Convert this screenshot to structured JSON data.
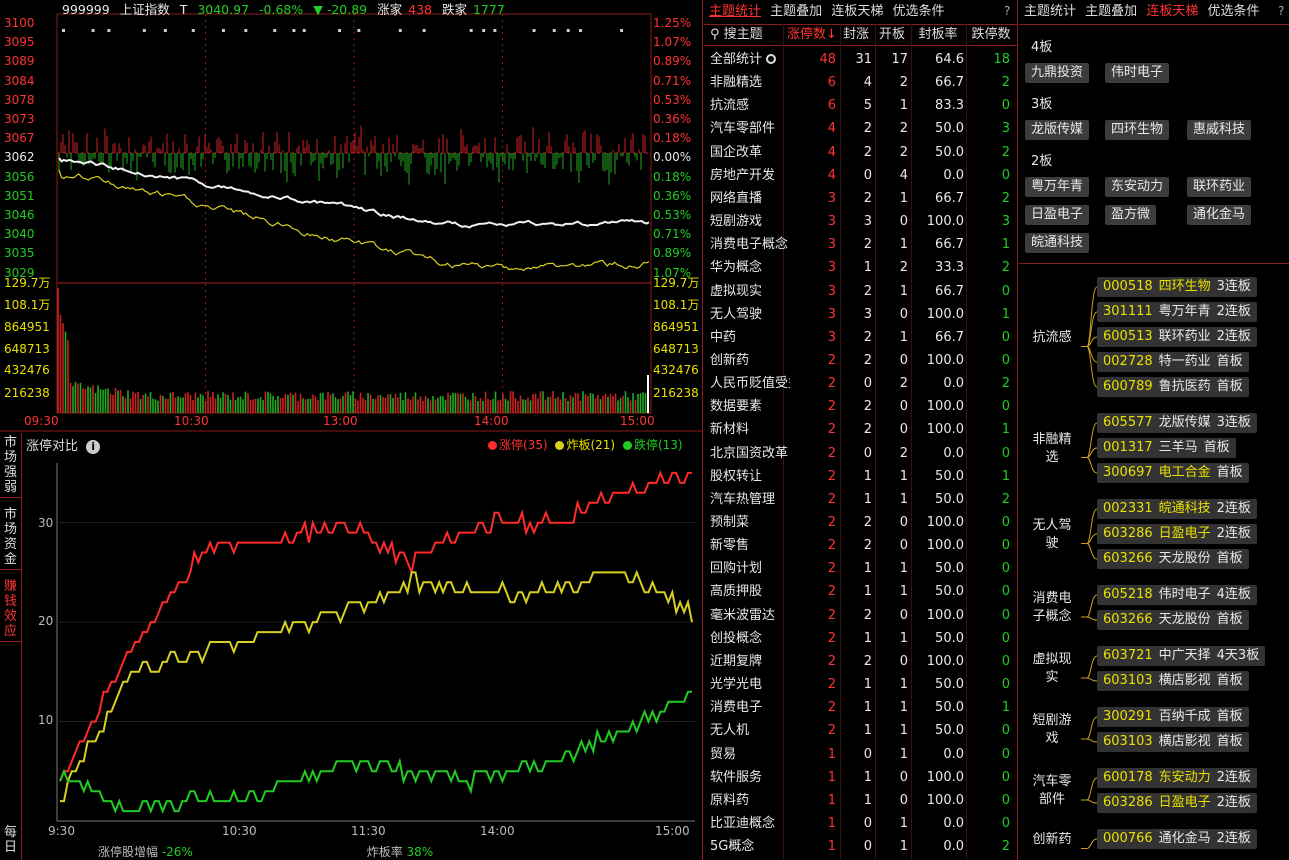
{
  "index_header": {
    "code": "999999",
    "name": "上证指数",
    "t_label": "T",
    "price": "3040.97",
    "pct": "-0.68%",
    "arrow": "▼",
    "change": "-20.89",
    "up_label": "涨家",
    "up_count": "438",
    "down_label": "跌家",
    "down_count": "1777"
  },
  "main_chart": {
    "price_labels": [
      "3100",
      "3095",
      "3089",
      "3084",
      "3078",
      "3073",
      "3067",
      "3062",
      "3056",
      "3051",
      "3046",
      "3040",
      "3035",
      "3029"
    ],
    "pct_labels": [
      "1.25%",
      "1.07%",
      "0.89%",
      "0.71%",
      "0.53%",
      "0.36%",
      "0.18%",
      "0.00%",
      "0.18%",
      "0.36%",
      "0.53%",
      "0.71%",
      "0.89%",
      "1.07%"
    ],
    "vol_labels": [
      "129.7万",
      "108.1万",
      "864951",
      "648713",
      "432476",
      "216238"
    ],
    "time_labels": [
      "09:30",
      "10:30",
      "13:00",
      "14:00",
      "15:00"
    ]
  },
  "compare": {
    "title": "涨停对比",
    "info_icon": "info-icon",
    "side_tabs": [
      "市场强弱",
      "市场资金",
      "赚钱效应",
      "每日"
    ],
    "legend": [
      {
        "label": "涨停(35)",
        "color": "#ff2a2a"
      },
      {
        "label": "炸板(21)",
        "color": "#d8d020"
      },
      {
        "label": "跌停(13)",
        "color": "#22cc22"
      }
    ],
    "y_ticks": [
      "30",
      "20",
      "10"
    ],
    "x_ticks": [
      "9:30",
      "10:30",
      "11:30",
      "14:00",
      "15:00"
    ],
    "footer_label1": "涨停股增幅",
    "footer_value1": "-26%",
    "footer_label2": "炸板率",
    "footer_value2": "38%"
  },
  "chart_data": {
    "type": "line",
    "title": "涨停对比",
    "x": [
      "9:30",
      "10:30",
      "11:30",
      "14:00",
      "15:00"
    ],
    "ylim": [
      0,
      36
    ],
    "series": [
      {
        "name": "涨停(35)",
        "color": "#ff2a2a",
        "values": [
          4,
          17,
          27,
          28,
          30,
          26,
          30,
          30,
          33,
          35
        ]
      },
      {
        "name": "炸板(21)",
        "color": "#d8d020",
        "values": [
          2,
          15,
          17,
          19,
          21,
          24,
          23,
          23,
          25,
          21
        ]
      },
      {
        "name": "跌停(13)",
        "color": "#22cc22",
        "values": [
          5,
          1,
          2,
          3,
          6,
          5,
          4,
          6,
          9,
          13
        ]
      }
    ]
  },
  "middle": {
    "tabs": [
      "主题统计",
      "主题叠加",
      "连板天梯",
      "优选条件"
    ],
    "active_tab": 0,
    "help": "?",
    "search_label": "搜主题",
    "columns": [
      "涨停数↓",
      "封涨",
      "开板",
      "封板率",
      "跌停数"
    ],
    "rows": [
      {
        "name": "全部统计",
        "zt": "48",
        "fz": "31",
        "kb": "17",
        "rate": "64.6",
        "dt": "18"
      },
      {
        "name": "非融精选",
        "zt": "6",
        "fz": "4",
        "kb": "2",
        "rate": "66.7",
        "dt": "2"
      },
      {
        "name": "抗流感",
        "zt": "6",
        "fz": "5",
        "kb": "1",
        "rate": "83.3",
        "dt": "0"
      },
      {
        "name": "汽车零部件",
        "zt": "4",
        "fz": "2",
        "kb": "2",
        "rate": "50.0",
        "dt": "3"
      },
      {
        "name": "国企改革",
        "zt": "4",
        "fz": "2",
        "kb": "2",
        "rate": "50.0",
        "dt": "2"
      },
      {
        "name": "房地产开发",
        "zt": "4",
        "fz": "0",
        "kb": "4",
        "rate": "0.0",
        "dt": "0"
      },
      {
        "name": "网络直播",
        "zt": "3",
        "fz": "2",
        "kb": "1",
        "rate": "66.7",
        "dt": "2"
      },
      {
        "name": "短剧游戏",
        "zt": "3",
        "fz": "3",
        "kb": "0",
        "rate": "100.0",
        "dt": "3"
      },
      {
        "name": "消费电子概念",
        "zt": "3",
        "fz": "2",
        "kb": "1",
        "rate": "66.7",
        "dt": "1"
      },
      {
        "name": "华为概念",
        "zt": "3",
        "fz": "1",
        "kb": "2",
        "rate": "33.3",
        "dt": "2"
      },
      {
        "name": "虚拟现实",
        "zt": "3",
        "fz": "2",
        "kb": "1",
        "rate": "66.7",
        "dt": "0"
      },
      {
        "name": "无人驾驶",
        "zt": "3",
        "fz": "3",
        "kb": "0",
        "rate": "100.0",
        "dt": "1"
      },
      {
        "name": "中药",
        "zt": "3",
        "fz": "2",
        "kb": "1",
        "rate": "66.7",
        "dt": "0"
      },
      {
        "name": "创新药",
        "zt": "2",
        "fz": "2",
        "kb": "0",
        "rate": "100.0",
        "dt": "0"
      },
      {
        "name": "人民币贬值受益",
        "zt": "2",
        "fz": "0",
        "kb": "2",
        "rate": "0.0",
        "dt": "2"
      },
      {
        "name": "数据要素",
        "zt": "2",
        "fz": "2",
        "kb": "0",
        "rate": "100.0",
        "dt": "0"
      },
      {
        "name": "新材料",
        "zt": "2",
        "fz": "2",
        "kb": "0",
        "rate": "100.0",
        "dt": "1"
      },
      {
        "name": "北京国资改革",
        "zt": "2",
        "fz": "0",
        "kb": "2",
        "rate": "0.0",
        "dt": "0"
      },
      {
        "name": "股权转让",
        "zt": "2",
        "fz": "1",
        "kb": "1",
        "rate": "50.0",
        "dt": "1"
      },
      {
        "name": "汽车热管理",
        "zt": "2",
        "fz": "1",
        "kb": "1",
        "rate": "50.0",
        "dt": "2"
      },
      {
        "name": "预制菜",
        "zt": "2",
        "fz": "2",
        "kb": "0",
        "rate": "100.0",
        "dt": "0"
      },
      {
        "name": "新零售",
        "zt": "2",
        "fz": "2",
        "kb": "0",
        "rate": "100.0",
        "dt": "0"
      },
      {
        "name": "回购计划",
        "zt": "2",
        "fz": "1",
        "kb": "1",
        "rate": "50.0",
        "dt": "0"
      },
      {
        "name": "高质押股",
        "zt": "2",
        "fz": "1",
        "kb": "1",
        "rate": "50.0",
        "dt": "0"
      },
      {
        "name": "毫米波雷达",
        "zt": "2",
        "fz": "2",
        "kb": "0",
        "rate": "100.0",
        "dt": "0"
      },
      {
        "name": "创投概念",
        "zt": "2",
        "fz": "1",
        "kb": "1",
        "rate": "50.0",
        "dt": "0"
      },
      {
        "name": "近期复牌",
        "zt": "2",
        "fz": "2",
        "kb": "0",
        "rate": "100.0",
        "dt": "0"
      },
      {
        "name": "光学光电",
        "zt": "2",
        "fz": "1",
        "kb": "1",
        "rate": "50.0",
        "dt": "0"
      },
      {
        "name": "消费电子",
        "zt": "2",
        "fz": "1",
        "kb": "1",
        "rate": "50.0",
        "dt": "1"
      },
      {
        "name": "无人机",
        "zt": "2",
        "fz": "1",
        "kb": "1",
        "rate": "50.0",
        "dt": "0"
      },
      {
        "name": "贸易",
        "zt": "1",
        "fz": "0",
        "kb": "1",
        "rate": "0.0",
        "dt": "0"
      },
      {
        "name": "软件服务",
        "zt": "1",
        "fz": "1",
        "kb": "0",
        "rate": "100.0",
        "dt": "0"
      },
      {
        "name": "原料药",
        "zt": "1",
        "fz": "1",
        "kb": "0",
        "rate": "100.0",
        "dt": "0"
      },
      {
        "name": "比亚迪概念",
        "zt": "1",
        "fz": "0",
        "kb": "1",
        "rate": "0.0",
        "dt": "0"
      },
      {
        "name": "5G概念",
        "zt": "1",
        "fz": "0",
        "kb": "1",
        "rate": "0.0",
        "dt": "2"
      }
    ]
  },
  "right": {
    "tabs": [
      "主题统计",
      "主题叠加",
      "连板天梯",
      "优选条件"
    ],
    "active_tab": 2,
    "help": "?",
    "ladder": [
      {
        "level": "4板",
        "stocks": [
          "九鼎投资",
          "伟时电子"
        ]
      },
      {
        "level": "3板",
        "stocks": [
          "龙版传媒",
          "四环生物",
          "惠威科技"
        ]
      },
      {
        "level": "2板",
        "stocks": [
          "粤万年青",
          "东安动力",
          "联环药业",
          "日盈电子",
          "盈方微",
          "通化金马",
          "皖通科技"
        ]
      }
    ],
    "themes": [
      {
        "name": "抗流感",
        "stocks": [
          {
            "code": "000518",
            "name": "四环生物",
            "board": "3连板",
            "hl": true
          },
          {
            "code": "301111",
            "name": "粤万年青",
            "board": "2连板",
            "hl": false
          },
          {
            "code": "600513",
            "name": "联环药业",
            "board": "2连板",
            "hl": false
          },
          {
            "code": "002728",
            "name": "特一药业",
            "board": "首板",
            "hl": false
          },
          {
            "code": "600789",
            "name": "鲁抗医药",
            "board": "首板",
            "hl": false
          }
        ]
      },
      {
        "name": "非融精选",
        "stocks": [
          {
            "code": "605577",
            "name": "龙版传媒",
            "board": "3连板",
            "hl": false
          },
          {
            "code": "001317",
            "name": "三羊马",
            "board": "首板",
            "hl": false
          },
          {
            "code": "300697",
            "name": "电工合金",
            "board": "首板",
            "hl": true
          }
        ]
      },
      {
        "name": "无人驾驶",
        "stocks": [
          {
            "code": "002331",
            "name": "皖通科技",
            "board": "2连板",
            "hl": true
          },
          {
            "code": "603286",
            "name": "日盈电子",
            "board": "2连板",
            "hl": true
          },
          {
            "code": "603266",
            "name": "天龙股份",
            "board": "首板",
            "hl": false
          }
        ]
      },
      {
        "name": "消费电子概念",
        "stocks": [
          {
            "code": "605218",
            "name": "伟时电子",
            "board": "4连板",
            "hl": false
          },
          {
            "code": "603266",
            "name": "天龙股份",
            "board": "首板",
            "hl": false
          }
        ]
      },
      {
        "name": "虚拟现实",
        "stocks": [
          {
            "code": "603721",
            "name": "中广天择",
            "board": "4天3板",
            "hl": false
          },
          {
            "code": "603103",
            "name": "横店影视",
            "board": "首板",
            "hl": false
          }
        ]
      },
      {
        "name": "短剧游戏",
        "stocks": [
          {
            "code": "300291",
            "name": "百纳千成",
            "board": "首板",
            "hl": false
          },
          {
            "code": "603103",
            "name": "横店影视",
            "board": "首板",
            "hl": false
          }
        ]
      },
      {
        "name": "汽车零部件",
        "stocks": [
          {
            "code": "600178",
            "name": "东安动力",
            "board": "2连板",
            "hl": true
          },
          {
            "code": "603286",
            "name": "日盈电子",
            "board": "2连板",
            "hl": true
          }
        ]
      },
      {
        "name": "创新药",
        "stocks": [
          {
            "code": "000766",
            "name": "通化金马",
            "board": "2连板",
            "hl": false
          }
        ]
      }
    ]
  }
}
